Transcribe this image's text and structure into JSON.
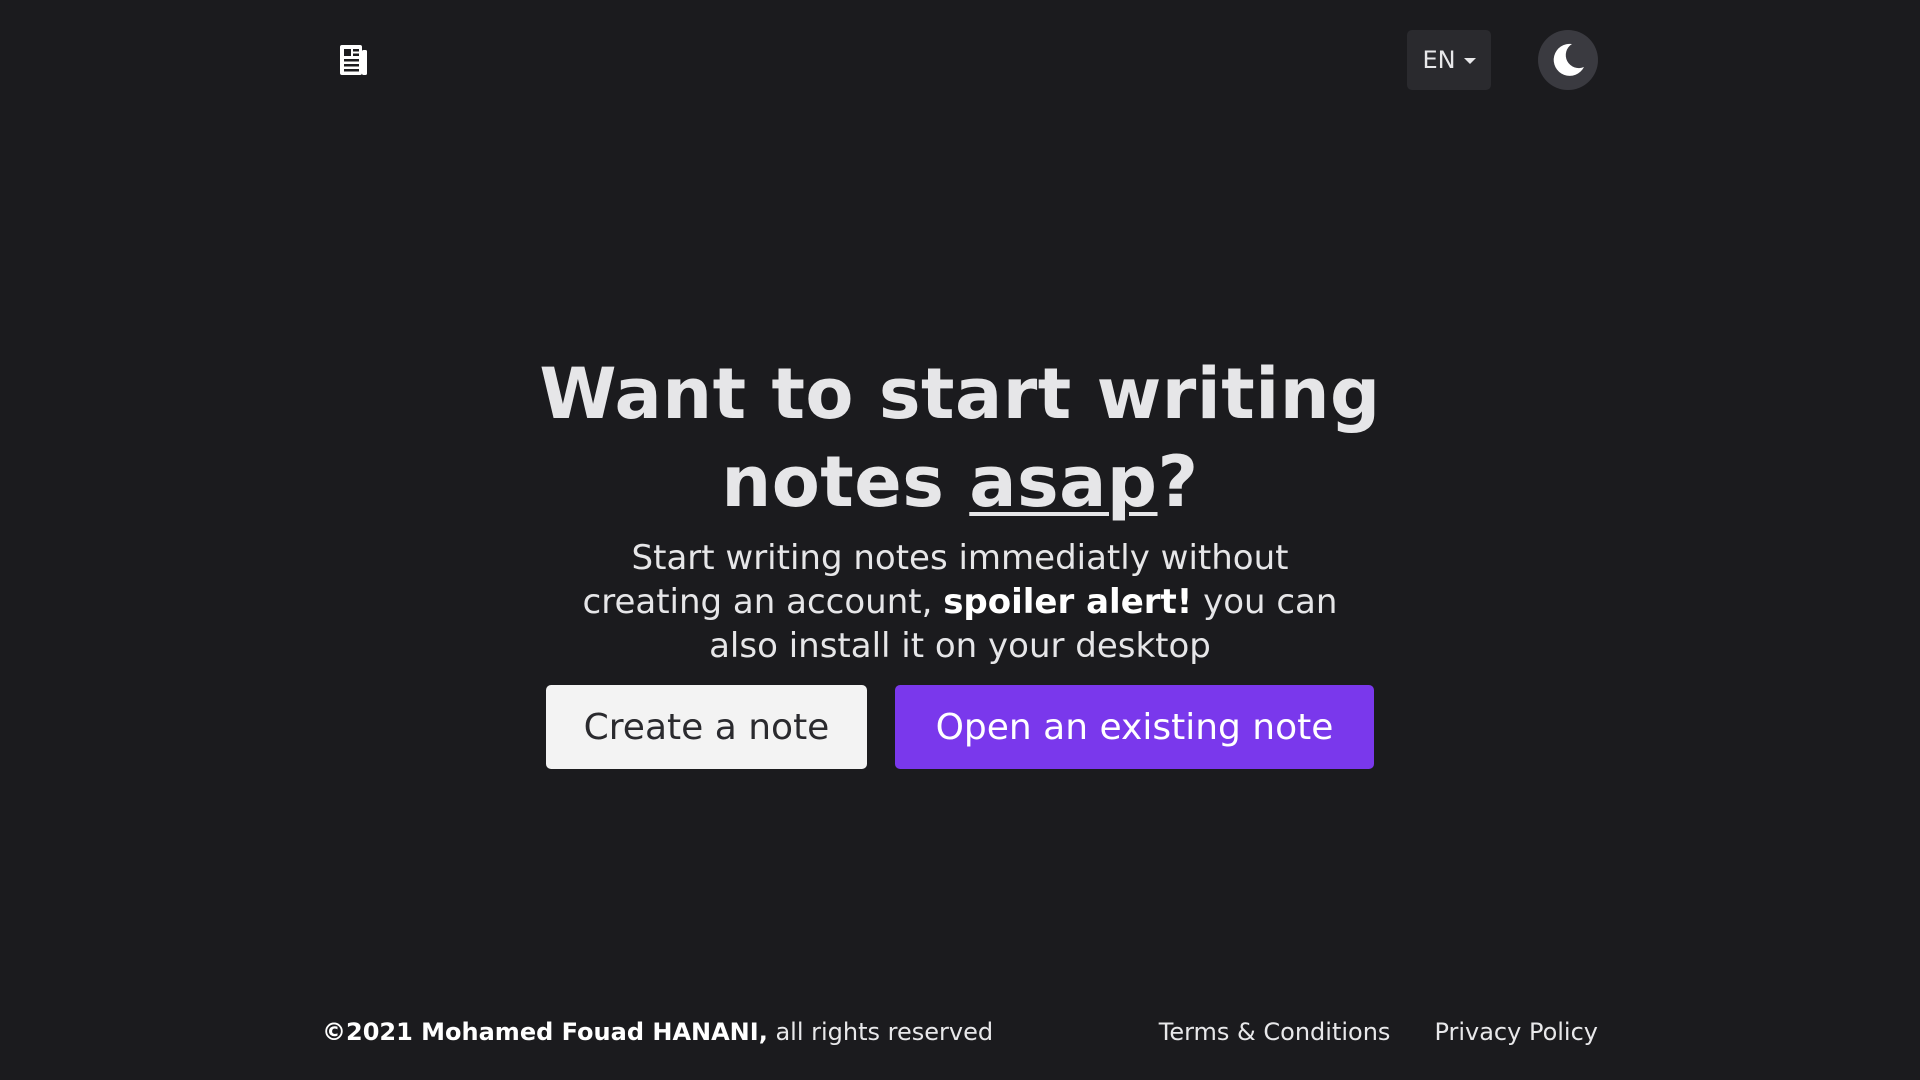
{
  "header": {
    "logo_icon": "newspaper-icon",
    "language": "EN",
    "theme_icon": "moon-icon"
  },
  "hero": {
    "title_line1": "Want to start writing",
    "title_line2_prefix": "notes ",
    "title_line2_underlined": "asap",
    "title_line2_suffix": "?",
    "subtitle_part1": "Start writing notes immediatly without creating an account, ",
    "subtitle_bold": "spoiler alert!",
    "subtitle_part2": " you can also install it on your desktop"
  },
  "actions": {
    "create_label": "Create a note",
    "open_label": "Open an existing note"
  },
  "footer": {
    "copyright_bold": "©2021 Mohamed Fouad HANANI,",
    "copyright_rest": " all rights reserved",
    "terms_label": "Terms & Conditions",
    "privacy_label": "Privacy Policy"
  },
  "colors": {
    "background": "#1b1b1e",
    "primary": "#7a38ec",
    "secondary_button": "#f3f3f3"
  }
}
